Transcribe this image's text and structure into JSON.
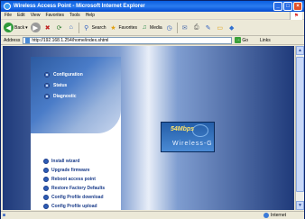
{
  "window": {
    "title": "Wireless Access Point - Microsoft Internet Explorer",
    "controls": [
      "_",
      "□",
      "×"
    ]
  },
  "menu": [
    "File",
    "Edit",
    "View",
    "Favorites",
    "Tools",
    "Help"
  ],
  "toolbar": {
    "back": "Back",
    "search": "Search",
    "favorites": "Favorites",
    "media": "Media"
  },
  "address": {
    "label": "Address",
    "url": "http://192.168.1.254/home/index.shtml",
    "go": "Go",
    "links": "Links"
  },
  "nav": {
    "top_items": [
      "Configuration",
      "Status",
      "Diagnostic"
    ],
    "bottom_items": [
      "Install wizard",
      "Upgrade firmware",
      "Reboot access point",
      "Restore Factory Defaults",
      "Config Profile download",
      "Config Profile upload"
    ]
  },
  "logo": {
    "speed": "54Mbps",
    "brand": "Wireless-G"
  },
  "status": {
    "zone": "Internet"
  },
  "colors": {
    "accent": "#1a3c8a",
    "titlebar": "#0a5ee0"
  }
}
